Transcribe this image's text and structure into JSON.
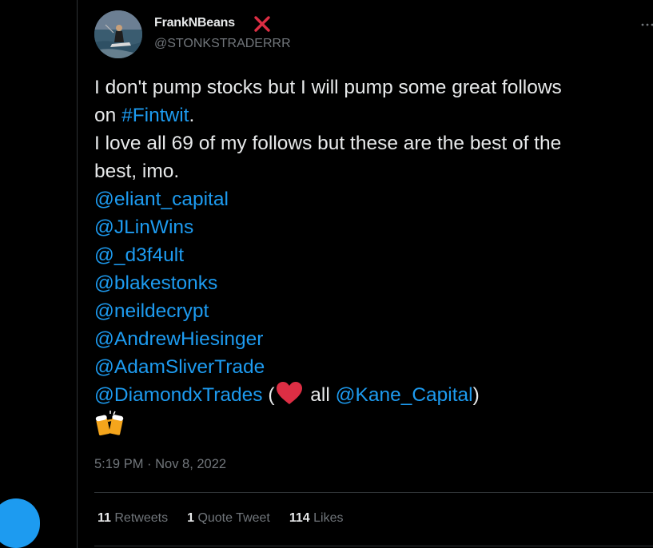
{
  "author": {
    "display_name": "FrankNBeans",
    "handle": "@STONKSTRADERRR",
    "name_emoji_icon": "cross-mark-icon"
  },
  "tweet": {
    "text_lines": [
      "I don't pump stocks but I will pump some great follows",
      "I love all 69 of my follows but these are the best of the",
      "best, imo."
    ],
    "line2_prefix": "on ",
    "hashtag": "#Fintwit",
    "line2_suffix": ".",
    "mentions": [
      "@eliant_capital",
      "@JLinWins",
      "@_d3f4ult",
      "@blakestonks",
      "@neildecrypt",
      "@AndrewHiesinger",
      "@AdamSliverTrade",
      "@DiamondxTrades"
    ],
    "last_line_open": " (",
    "last_line_middle": " all ",
    "last_line_mention": "@Kane_Capital",
    "last_line_close": ")",
    "emojis": [
      "red-heart-icon",
      "clinking-beer-mugs-icon"
    ]
  },
  "timestamp": "5:19 PM · Nov 8, 2022",
  "stats": {
    "retweets_count": "11",
    "retweets_label": "Retweets",
    "quotes_count": "1",
    "quotes_label": "Quote Tweet",
    "likes_count": "114",
    "likes_label": "Likes"
  },
  "colors": {
    "background": "#000000",
    "text": "#e7e9ea",
    "muted": "#71767b",
    "link": "#1d9bf0",
    "divider": "#2f3336"
  }
}
